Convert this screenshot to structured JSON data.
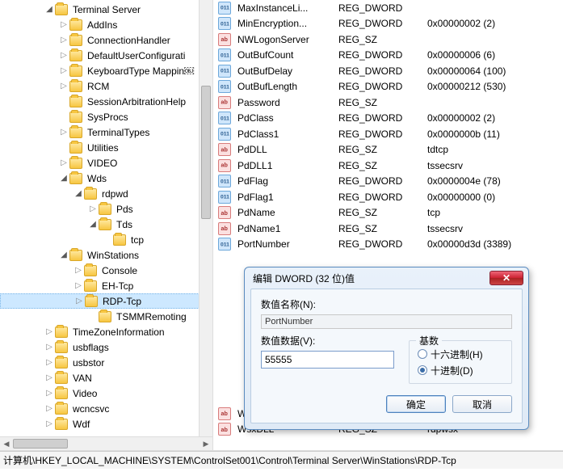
{
  "tree": [
    {
      "indent": 3,
      "exp": "open",
      "label": "Terminal Server"
    },
    {
      "indent": 4,
      "exp": "closed",
      "label": "AddIns"
    },
    {
      "indent": 4,
      "exp": "closed",
      "label": "ConnectionHandler"
    },
    {
      "indent": 4,
      "exp": "closed",
      "label": "DefaultUserConfigurati"
    },
    {
      "indent": 4,
      "exp": "closed",
      "label": "KeyboardType Mappin￼"
    },
    {
      "indent": 4,
      "exp": "closed",
      "label": "RCM"
    },
    {
      "indent": 4,
      "exp": "none",
      "label": "SessionArbitrationHelp"
    },
    {
      "indent": 4,
      "exp": "none",
      "label": "SysProcs"
    },
    {
      "indent": 4,
      "exp": "closed",
      "label": "TerminalTypes"
    },
    {
      "indent": 4,
      "exp": "none",
      "label": "Utilities"
    },
    {
      "indent": 4,
      "exp": "closed",
      "label": "VIDEO"
    },
    {
      "indent": 4,
      "exp": "open",
      "label": "Wds"
    },
    {
      "indent": 5,
      "exp": "open",
      "label": "rdpwd"
    },
    {
      "indent": 6,
      "exp": "closed",
      "label": "Pds"
    },
    {
      "indent": 6,
      "exp": "open",
      "label": "Tds"
    },
    {
      "indent": 7,
      "exp": "none",
      "label": "tcp"
    },
    {
      "indent": 4,
      "exp": "open",
      "label": "WinStations"
    },
    {
      "indent": 5,
      "exp": "closed",
      "label": "Console"
    },
    {
      "indent": 5,
      "exp": "closed",
      "label": "EH-Tcp"
    },
    {
      "indent": 5,
      "exp": "closed",
      "label": "RDP-Tcp",
      "selected": true
    },
    {
      "indent": 6,
      "exp": "none",
      "label": "TSMMRemoting"
    },
    {
      "indent": 3,
      "exp": "closed",
      "label": "TimeZoneInformation"
    },
    {
      "indent": 3,
      "exp": "closed",
      "label": "usbflags"
    },
    {
      "indent": 3,
      "exp": "closed",
      "label": "usbstor"
    },
    {
      "indent": 3,
      "exp": "closed",
      "label": "VAN"
    },
    {
      "indent": 3,
      "exp": "closed",
      "label": "Video"
    },
    {
      "indent": 3,
      "exp": "closed",
      "label": "wcncsvc"
    },
    {
      "indent": 3,
      "exp": "closed",
      "label": "Wdf"
    }
  ],
  "values": [
    {
      "icon": "dword",
      "name": "MaxInstanceLi...",
      "type": "REG_DWORD",
      "data": ""
    },
    {
      "icon": "dword",
      "name": "MinEncryption...",
      "type": "REG_DWORD",
      "data": "0x00000002 (2)"
    },
    {
      "icon": "sz",
      "name": "NWLogonServer",
      "type": "REG_SZ",
      "data": ""
    },
    {
      "icon": "dword",
      "name": "OutBufCount",
      "type": "REG_DWORD",
      "data": "0x00000006 (6)"
    },
    {
      "icon": "dword",
      "name": "OutBufDelay",
      "type": "REG_DWORD",
      "data": "0x00000064 (100)"
    },
    {
      "icon": "dword",
      "name": "OutBufLength",
      "type": "REG_DWORD",
      "data": "0x00000212 (530)"
    },
    {
      "icon": "sz",
      "name": "Password",
      "type": "REG_SZ",
      "data": ""
    },
    {
      "icon": "dword",
      "name": "PdClass",
      "type": "REG_DWORD",
      "data": "0x00000002 (2)"
    },
    {
      "icon": "dword",
      "name": "PdClass1",
      "type": "REG_DWORD",
      "data": "0x0000000b (11)"
    },
    {
      "icon": "sz",
      "name": "PdDLL",
      "type": "REG_SZ",
      "data": "tdtcp"
    },
    {
      "icon": "sz",
      "name": "PdDLL1",
      "type": "REG_SZ",
      "data": "tssecsrv"
    },
    {
      "icon": "dword",
      "name": "PdFlag",
      "type": "REG_DWORD",
      "data": "0x0000004e (78)"
    },
    {
      "icon": "dword",
      "name": "PdFlag1",
      "type": "REG_DWORD",
      "data": "0x00000000 (0)"
    },
    {
      "icon": "sz",
      "name": "PdName",
      "type": "REG_SZ",
      "data": "tcp"
    },
    {
      "icon": "sz",
      "name": "PdName1",
      "type": "REG_SZ",
      "data": "tssecsrv"
    },
    {
      "icon": "dword",
      "name": "PortNumber",
      "type": "REG_DWORD",
      "data": "0x00000d3d (3389)"
    },
    {
      "icon": "sz",
      "name": "WorkDirectory",
      "type": "REG_SZ",
      "data": ""
    },
    {
      "icon": "sz",
      "name": "WsxDLL",
      "type": "REG_SZ",
      "data": "rdpwsx"
    }
  ],
  "dialog": {
    "title": "编辑 DWORD (32 位)值",
    "name_label": "数值名称(N):",
    "name_value": "PortNumber",
    "data_label": "数值数据(V):",
    "data_value": "55555",
    "radix_label": "基数",
    "radix_hex": "十六进制(H)",
    "radix_dec": "十进制(D)",
    "ok": "确定",
    "cancel": "取消"
  },
  "status_bar": "计算机\\HKEY_LOCAL_MACHINE\\SYSTEM\\ControlSet001\\Control\\Terminal Server\\WinStations\\RDP-Tcp"
}
